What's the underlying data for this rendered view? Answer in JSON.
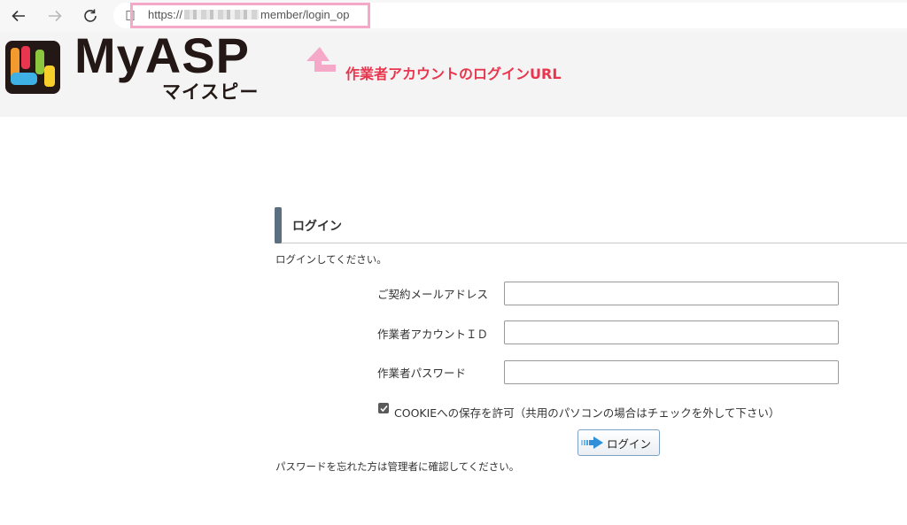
{
  "browser": {
    "url_prefix": "https://",
    "url_suffix": "member/login_op"
  },
  "header": {
    "brand_name": "MyASP",
    "brand_katakana": "マイスピー",
    "annotation": "作業者アカウントのログインURL"
  },
  "login": {
    "title": "ログイン",
    "intro": "ログインしてください。",
    "fields": [
      {
        "label": "ご契約メールアドレス",
        "value": ""
      },
      {
        "label": "作業者アカウントＩＤ",
        "value": ""
      },
      {
        "label": "作業者パスワード",
        "value": ""
      }
    ],
    "cookie_label": "COOKIEへの保存を許可（共用のパソコンの場合はチェックを外して下さい）",
    "cookie_checked": true,
    "submit_label": "ログイン",
    "forgot_text": "パスワードを忘れた方は管理者に確認してください。"
  },
  "colors": {
    "annotation": "#e8364f",
    "url_highlight": "#f6a8c9",
    "section_bar": "#5c6f80"
  },
  "icons": [
    "back-arrow-icon",
    "forward-arrow-icon",
    "reload-icon",
    "page-info-icon",
    "up-arrow-icon",
    "login-arrow-icon",
    "checkmark-icon"
  ]
}
